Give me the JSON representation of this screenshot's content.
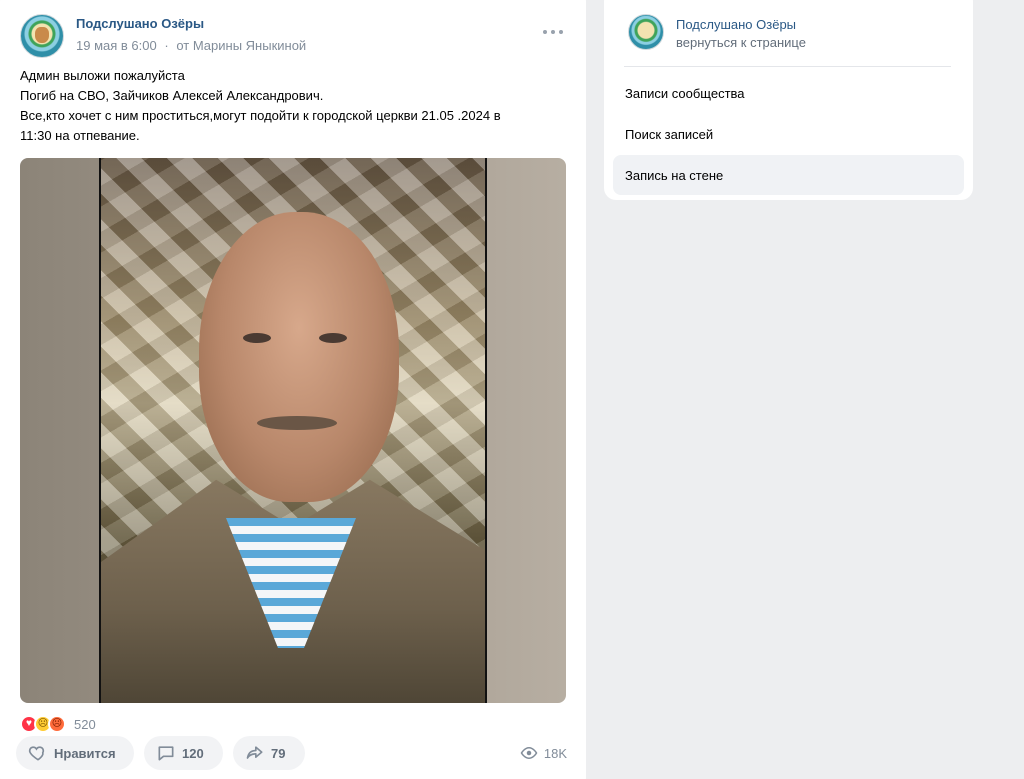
{
  "post": {
    "author": "Подслушано Озёры",
    "date": "19 мая в 6:00",
    "separator": "·",
    "from": "от Марины Яныкиной",
    "text_lines": [
      "Админ выложи пожалуйста",
      "Погиб на СВО, Зайчиков Алексей Александрович.",
      "Все,кто хочет с ним проститься,могут подойти к городской церкви 21.05 .2024 в",
      "11:30 на отпевание."
    ],
    "reactions": {
      "icons": [
        "heart-reaction-icon",
        "sad-reaction-icon",
        "angry-reaction-icon"
      ],
      "count": "520"
    },
    "actions": {
      "like_label": "Нравится",
      "comments_count": "120",
      "shares_count": "79",
      "views_count": "18K"
    }
  },
  "sidebar": {
    "community_name": "Подслушано Озёры",
    "back_label": "вернуться к странице",
    "items": [
      {
        "label": "Записи сообщества",
        "active": false
      },
      {
        "label": "Поиск записей",
        "active": false
      },
      {
        "label": "Запись на стене",
        "active": true
      }
    ]
  },
  "colors": {
    "background": "#edeef0",
    "link": "#2a5885",
    "muted": "#818c99",
    "button_bg": "#f2f3f5"
  }
}
